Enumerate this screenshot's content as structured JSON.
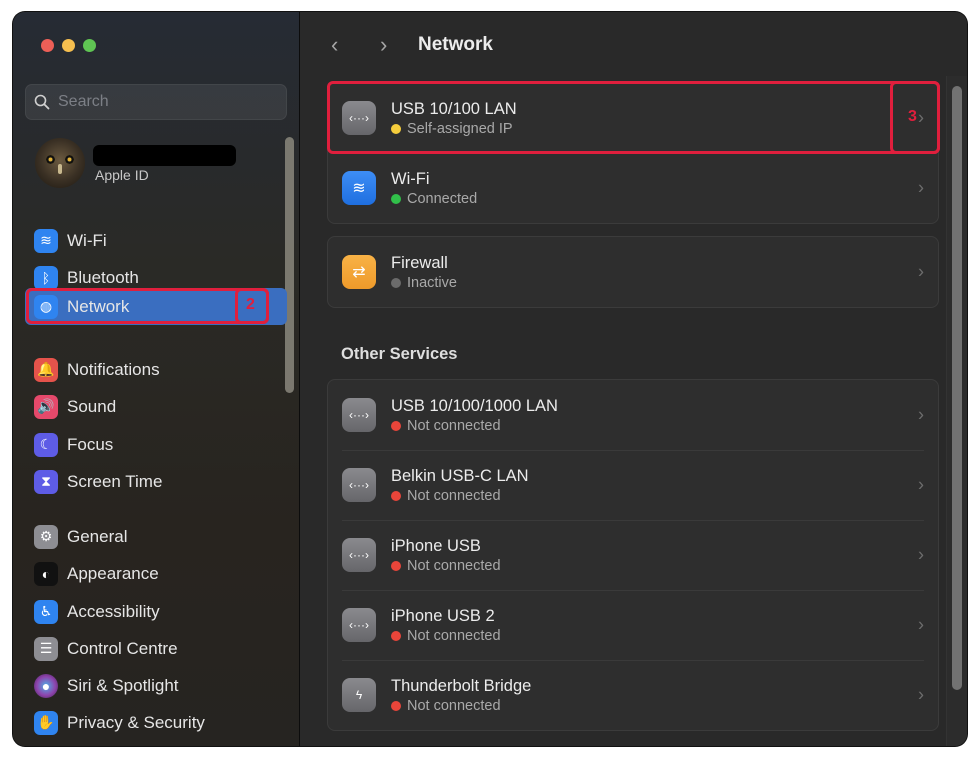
{
  "window": {
    "traffic_lights": [
      {
        "name": "close",
        "color": "#ed5f57"
      },
      {
        "name": "minimize",
        "color": "#f5be4f"
      },
      {
        "name": "zoom",
        "color": "#5fc453"
      }
    ]
  },
  "sidebar": {
    "search": {
      "placeholder": "Search",
      "value": ""
    },
    "profile": {
      "subtitle": "Apple ID"
    },
    "items": [
      {
        "id": "wifi",
        "label": "Wi-Fi",
        "icon": "wifi-icon",
        "color": "#2f84f0",
        "glyph": "≋"
      },
      {
        "id": "bluetooth",
        "label": "Bluetooth",
        "icon": "bluetooth-icon",
        "color": "#2f84f0",
        "glyph": "ᛒ"
      },
      {
        "id": "network",
        "label": "Network",
        "icon": "globe-icon",
        "color": "#2f84f0",
        "glyph": "◍",
        "active": true
      },
      {
        "id": "notifications",
        "label": "Notifications",
        "icon": "bell-icon",
        "color": "#e5534b",
        "glyph": "🔔"
      },
      {
        "id": "sound",
        "label": "Sound",
        "icon": "speaker-icon",
        "color": "#e5496b",
        "glyph": "🔊"
      },
      {
        "id": "focus",
        "label": "Focus",
        "icon": "moon-icon",
        "color": "#5e5ce6",
        "glyph": "☾"
      },
      {
        "id": "screen-time",
        "label": "Screen Time",
        "icon": "hourglass-icon",
        "color": "#5e5ce6",
        "glyph": "⧗"
      },
      {
        "id": "general",
        "label": "General",
        "icon": "gear-icon",
        "color": "#8e8e93",
        "glyph": "⚙"
      },
      {
        "id": "appearance",
        "label": "Appearance",
        "icon": "appearance-icon",
        "color": "#111111",
        "glyph": "◐"
      },
      {
        "id": "accessibility",
        "label": "Accessibility",
        "icon": "accessibility-icon",
        "color": "#2f84f0",
        "glyph": "♿"
      },
      {
        "id": "control-centre",
        "label": "Control Centre",
        "icon": "toggles-icon",
        "color": "#8e8e93",
        "glyph": "☰"
      },
      {
        "id": "siri-spotlight",
        "label": "Siri & Spotlight",
        "icon": "siri-icon",
        "color": "#7a3a8c",
        "glyph": "●"
      },
      {
        "id": "privacy-security",
        "label": "Privacy & Security",
        "icon": "hand-icon",
        "color": "#2f84f0",
        "glyph": "✋"
      }
    ],
    "annotation_label": "2"
  },
  "main": {
    "title": "Network",
    "back_label": "‹",
    "forward_label": "›",
    "primary_services": [
      {
        "name": "USB 10/100 LAN",
        "status": "Self-assigned IP",
        "status_color": "#f5cd3c",
        "icon": "ethernet-icon",
        "icon_style": "gray",
        "glyph": "‹···›"
      },
      {
        "name": "Wi-Fi",
        "status": "Connected",
        "status_color": "#31c04a",
        "icon": "wifi-icon",
        "icon_style": "blue",
        "glyph": "≋"
      }
    ],
    "firewall": {
      "name": "Firewall",
      "status": "Inactive",
      "status_color": "#6b6b6b",
      "icon": "firewall-shield-icon",
      "glyph": "⇄"
    },
    "other_services_title": "Other Services",
    "other_services": [
      {
        "name": "USB 10/100/1000 LAN",
        "status": "Not connected",
        "status_color": "#e9453a",
        "icon": "ethernet-icon",
        "glyph": "‹···›"
      },
      {
        "name": "Belkin USB-C LAN",
        "status": "Not connected",
        "status_color": "#e9453a",
        "icon": "ethernet-icon",
        "glyph": "‹···›"
      },
      {
        "name": "iPhone USB",
        "status": "Not connected",
        "status_color": "#e9453a",
        "icon": "ethernet-icon",
        "glyph": "‹···›"
      },
      {
        "name": "iPhone USB 2",
        "status": "Not connected",
        "status_color": "#e9453a",
        "icon": "ethernet-icon",
        "glyph": "‹···›"
      },
      {
        "name": "Thunderbolt Bridge",
        "status": "Not connected",
        "status_color": "#e9453a",
        "icon": "thunderbolt-icon",
        "glyph": "ϟ"
      }
    ],
    "chevron": "›",
    "annotation_label": "3"
  },
  "colors": {
    "annotation": "#e01f3d",
    "selection": "#3a6ec0"
  }
}
